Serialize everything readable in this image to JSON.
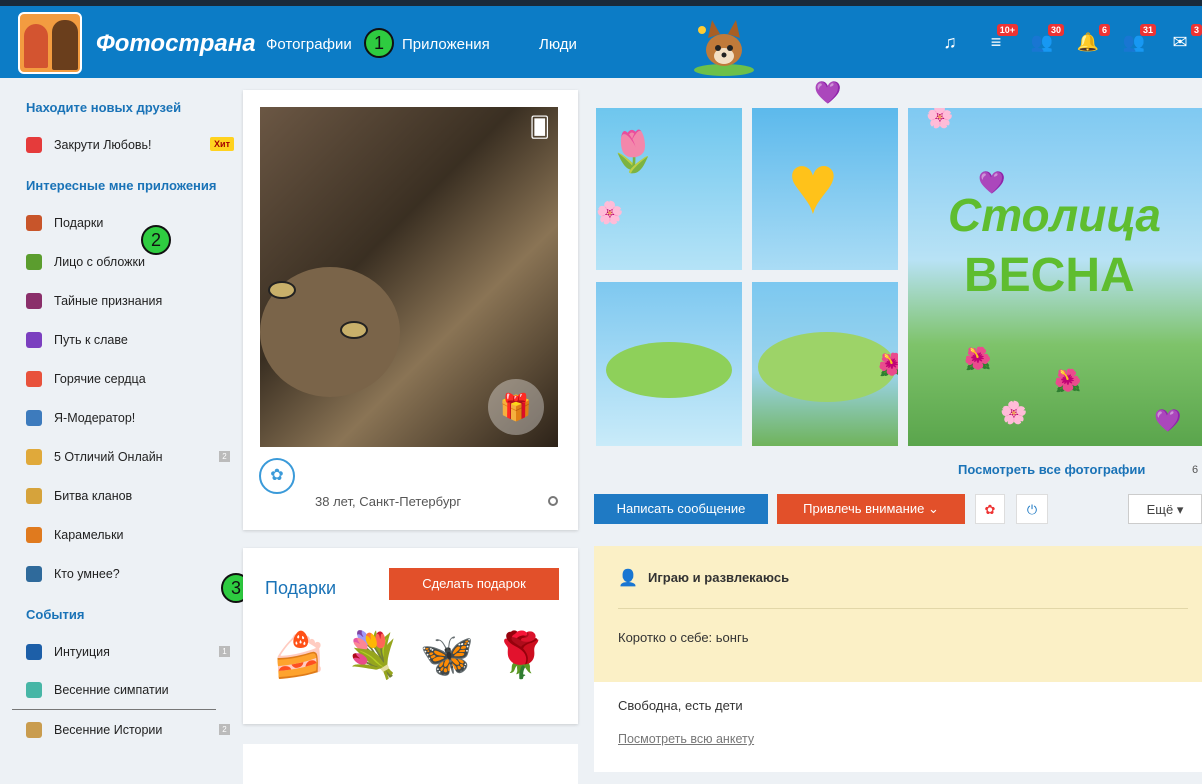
{
  "header": {
    "logo_text": "Фотострана",
    "nav": [
      "Фотографии",
      "Приложения",
      "Люди"
    ],
    "markers": [
      "1",
      "2",
      "3"
    ],
    "icons": [
      {
        "name": "music-icon",
        "glyph": "♫",
        "badge": ""
      },
      {
        "name": "feed-icon",
        "glyph": "≡",
        "badge": "10+"
      },
      {
        "name": "guests-icon",
        "glyph": "👥",
        "badge": "30"
      },
      {
        "name": "notifications-icon",
        "glyph": "🔔",
        "badge": "6"
      },
      {
        "name": "friends-icon",
        "glyph": "👥",
        "badge": "31"
      },
      {
        "name": "messages-icon",
        "glyph": "✉",
        "badge": "3"
      }
    ]
  },
  "sidebar": {
    "section1_title": "Находите новых друзей",
    "section1_items": [
      {
        "label": "Закрути Любовь!",
        "badge": "Хит",
        "color": "#e53b3b"
      }
    ],
    "section2_title": "Интересные мне приложения",
    "section2_items": [
      {
        "label": "Подарки",
        "color": "#c8552a"
      },
      {
        "label": "Лицо с обложки",
        "color": "#5b9d2e"
      },
      {
        "label": "Тайные признания",
        "color": "#8a2f6a"
      },
      {
        "label": "Путь к славе",
        "color": "#7b3fbf"
      },
      {
        "label": "Горячие сердца",
        "color": "#e8523c"
      },
      {
        "label": "Я-Модератор!",
        "color": "#3d7bbd"
      },
      {
        "label": "5 Отличий Онлайн",
        "color": "#e0a93a",
        "count": "2"
      },
      {
        "label": "Битва кланов",
        "color": "#d6a33b"
      },
      {
        "label": "Карамельки",
        "color": "#e07a1e"
      },
      {
        "label": "Кто умнее?",
        "color": "#2f6a9b"
      }
    ],
    "section3_title": "События",
    "section3_items": [
      {
        "label": "Интуиция",
        "color": "#1d5fa8",
        "count": "1"
      },
      {
        "label": "Весенние симпатии",
        "color": "#47b6a6"
      },
      {
        "label": "Весенние Истории",
        "color": "#c99c4e",
        "count": "2"
      }
    ]
  },
  "profile": {
    "age_city": "38 лет, Санкт-Петербург"
  },
  "gifts": {
    "title": "Подарки",
    "button": "Сделать подарок",
    "items": [
      "🍰",
      "💐",
      "🦋",
      "🌹"
    ]
  },
  "collage": {
    "spring_top": "Столица",
    "spring_bottom": "ВЕСНА"
  },
  "photos": {
    "see_all": "Посмотреть все фотографии",
    "count": "6"
  },
  "actions": {
    "message": "Написать сообщение",
    "attention": "Привлечь внимание ⌄",
    "more": "Ещё ▾"
  },
  "info": {
    "status": "Играю и развлекаюсь",
    "about": "Коротко о себе: ьонгь",
    "marital": "Свободна, есть дети",
    "full_profile": "Посмотреть всю анкету"
  }
}
